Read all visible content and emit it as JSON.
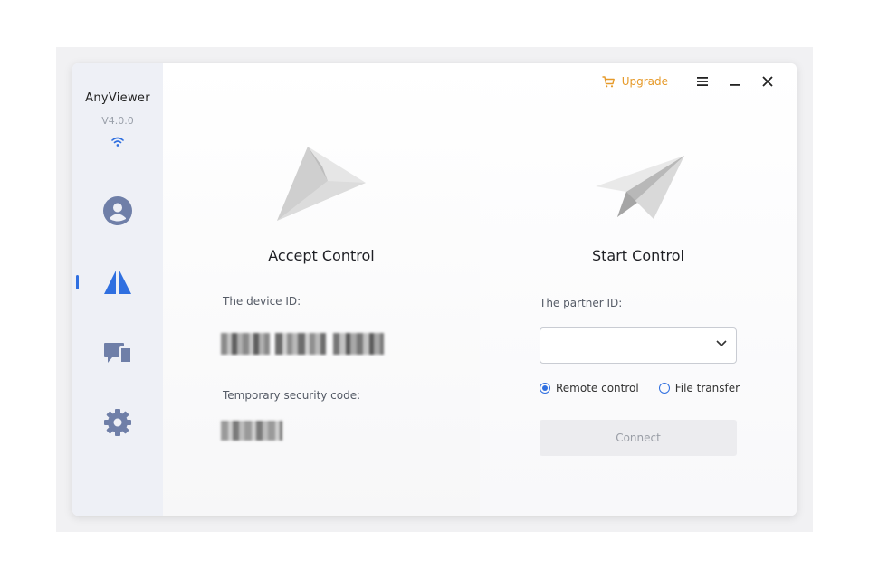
{
  "app": {
    "name": "AnyViewer",
    "version": "V4.0.0"
  },
  "sidebar": {
    "items": [
      {
        "name": "account",
        "icon": "user-circle-icon"
      },
      {
        "name": "connect",
        "icon": "anyviewer-logo-icon",
        "active": true
      },
      {
        "name": "devices",
        "icon": "devices-icon"
      },
      {
        "name": "settings",
        "icon": "gear-icon"
      }
    ]
  },
  "titlebar": {
    "upgrade_label": "Upgrade",
    "upgrade_icon": "cart-icon",
    "menu_icon": "hamburger-icon",
    "minimize_icon": "minimize-icon",
    "close_icon": "close-icon"
  },
  "accept": {
    "title": "Accept Control",
    "device_id_label": "The device ID:",
    "security_code_label": "Temporary security code:"
  },
  "start": {
    "title": "Start Control",
    "partner_id_label": "The partner ID:",
    "partner_id_value": "",
    "radio_remote": "Remote control",
    "radio_file": "File transfer",
    "selected_mode": "Remote control",
    "connect_label": "Connect"
  },
  "colors": {
    "accent": "#2f6fe0",
    "upgrade": "#e69a2a",
    "sidebar_bg": "#eef0f6",
    "nav_icon": "#6f7fa8"
  }
}
